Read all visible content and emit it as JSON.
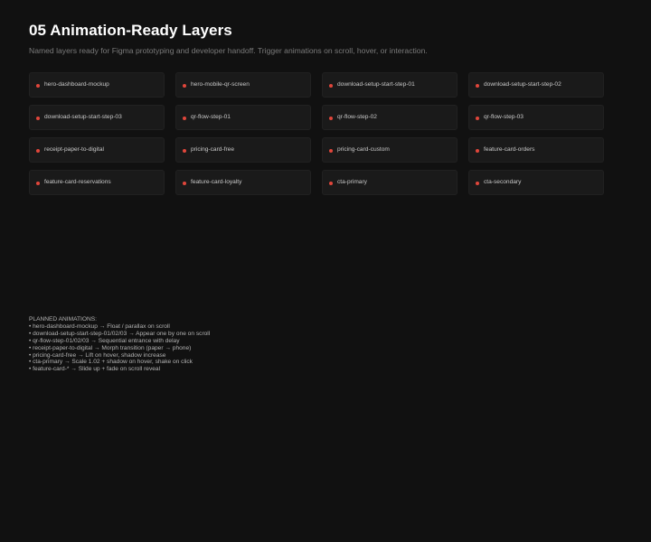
{
  "header": {
    "title": "05 Animation-Ready Layers",
    "subtitle": "Named layers ready for Figma prototyping and developer handoff. Trigger animations on scroll, hover, or interaction."
  },
  "colors": {
    "background": "#111111",
    "card": "#1a1a1a",
    "dot": "#e0463b"
  },
  "layers": [
    "hero-dashboard-mockup",
    "hero-mobile-qr-screen",
    "download-setup-start-step-01",
    "download-setup-start-step-02",
    "download-setup-start-step-03",
    "qr-flow-step-01",
    "qr-flow-step-02",
    "qr-flow-step-03",
    "receipt-paper-to-digital",
    "pricing-card-free",
    "pricing-card-custom",
    "feature-card-orders",
    "feature-card-reservations",
    "feature-card-loyalty",
    "cta-primary",
    "cta-secondary"
  ],
  "animations": {
    "heading": "PLANNED ANIMATIONS:",
    "items": [
      "• hero-dashboard-mockup → Float / parallax on scroll",
      "• download-setup-start-step-01/02/03 → Appear one by one on scroll",
      "• qr-flow-step-01/02/03 → Sequential entrance with delay",
      "• receipt-paper-to-digital → Morph transition (paper → phone)",
      "• pricing-card-free → Lift on hover, shadow increase",
      "• cta-primary → Scale 1.02 + shadow on hover, shake on click",
      "• feature-card-* → Slide up + fade on scroll reveal"
    ]
  }
}
